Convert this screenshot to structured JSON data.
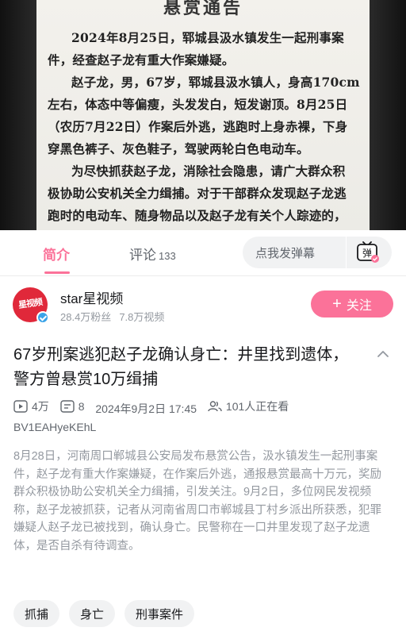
{
  "video": {
    "notice_title": "悬赏通告",
    "lines": [
      "2024年8月25日，郓城县汲水镇发生一起刑事案",
      "件，经查赵子龙有重大作案嫌疑。",
      "赵子龙，男，67岁，郓城县汲水镇人，身高170cm",
      "左右，体态中等偏瘦，头发发白，短发谢顶。8月25日",
      "（农历7月22日）作案后外逃，逃跑时上身赤裸，下身",
      "穿黑色裤子、灰色鞋子，驾驶两轮白色电动车。",
      "为尽快抓获赵子龙，消除社会隐患，请广大群众积",
      "极协助公安机关全力缉捕。对于干部群众发现赵子龙逃",
      "跑时的电动车、随身物品以及赵子龙有关个人踪迹的，"
    ]
  },
  "tabs": {
    "intro_label": "简介",
    "comments_label": "评论",
    "comments_count": "133",
    "danmaku_placeholder": "点我发弹幕",
    "danmaku_icon_text": "弹"
  },
  "uploader": {
    "avatar_text": "星视频",
    "name": "star星视频",
    "fans": "28.4万粉丝",
    "videos": "7.8万视频",
    "follow_plus": "+",
    "follow_label": "关注"
  },
  "title": "67岁刑案逃犯赵子龙确认身亡：井里找到遗体，警方曾悬赏10万缉捕",
  "meta": {
    "views": "4万",
    "danmaku": "8",
    "date": "2024年9月2日 17:45",
    "watching": "101人正在看",
    "bvid": "BV1EAHyeKEhL"
  },
  "description": "8月28日，河南周口郸城县公安局发布悬赏公告，汲水镇发生一起刑事案件，赵子龙有重大作案嫌疑，在作案后外逃，通报悬赏最高十万元，奖励群众积极协助公安机关全力缉捕，引发关注。9月2日，多位网民发视频称，赵子龙被抓获，记者从河南省周口市郸城县丁村乡派出所获悉，犯罪嫌疑人赵子龙已被找到，确认身亡。民警称在一口井里发现了赵子龙遗体，是否自杀有待调查。",
  "tags": [
    "抓捕",
    "身亡",
    "刑事案件"
  ],
  "colors": {
    "accent": "#fb7299",
    "text": "#18191c",
    "muted": "#9499a0"
  }
}
